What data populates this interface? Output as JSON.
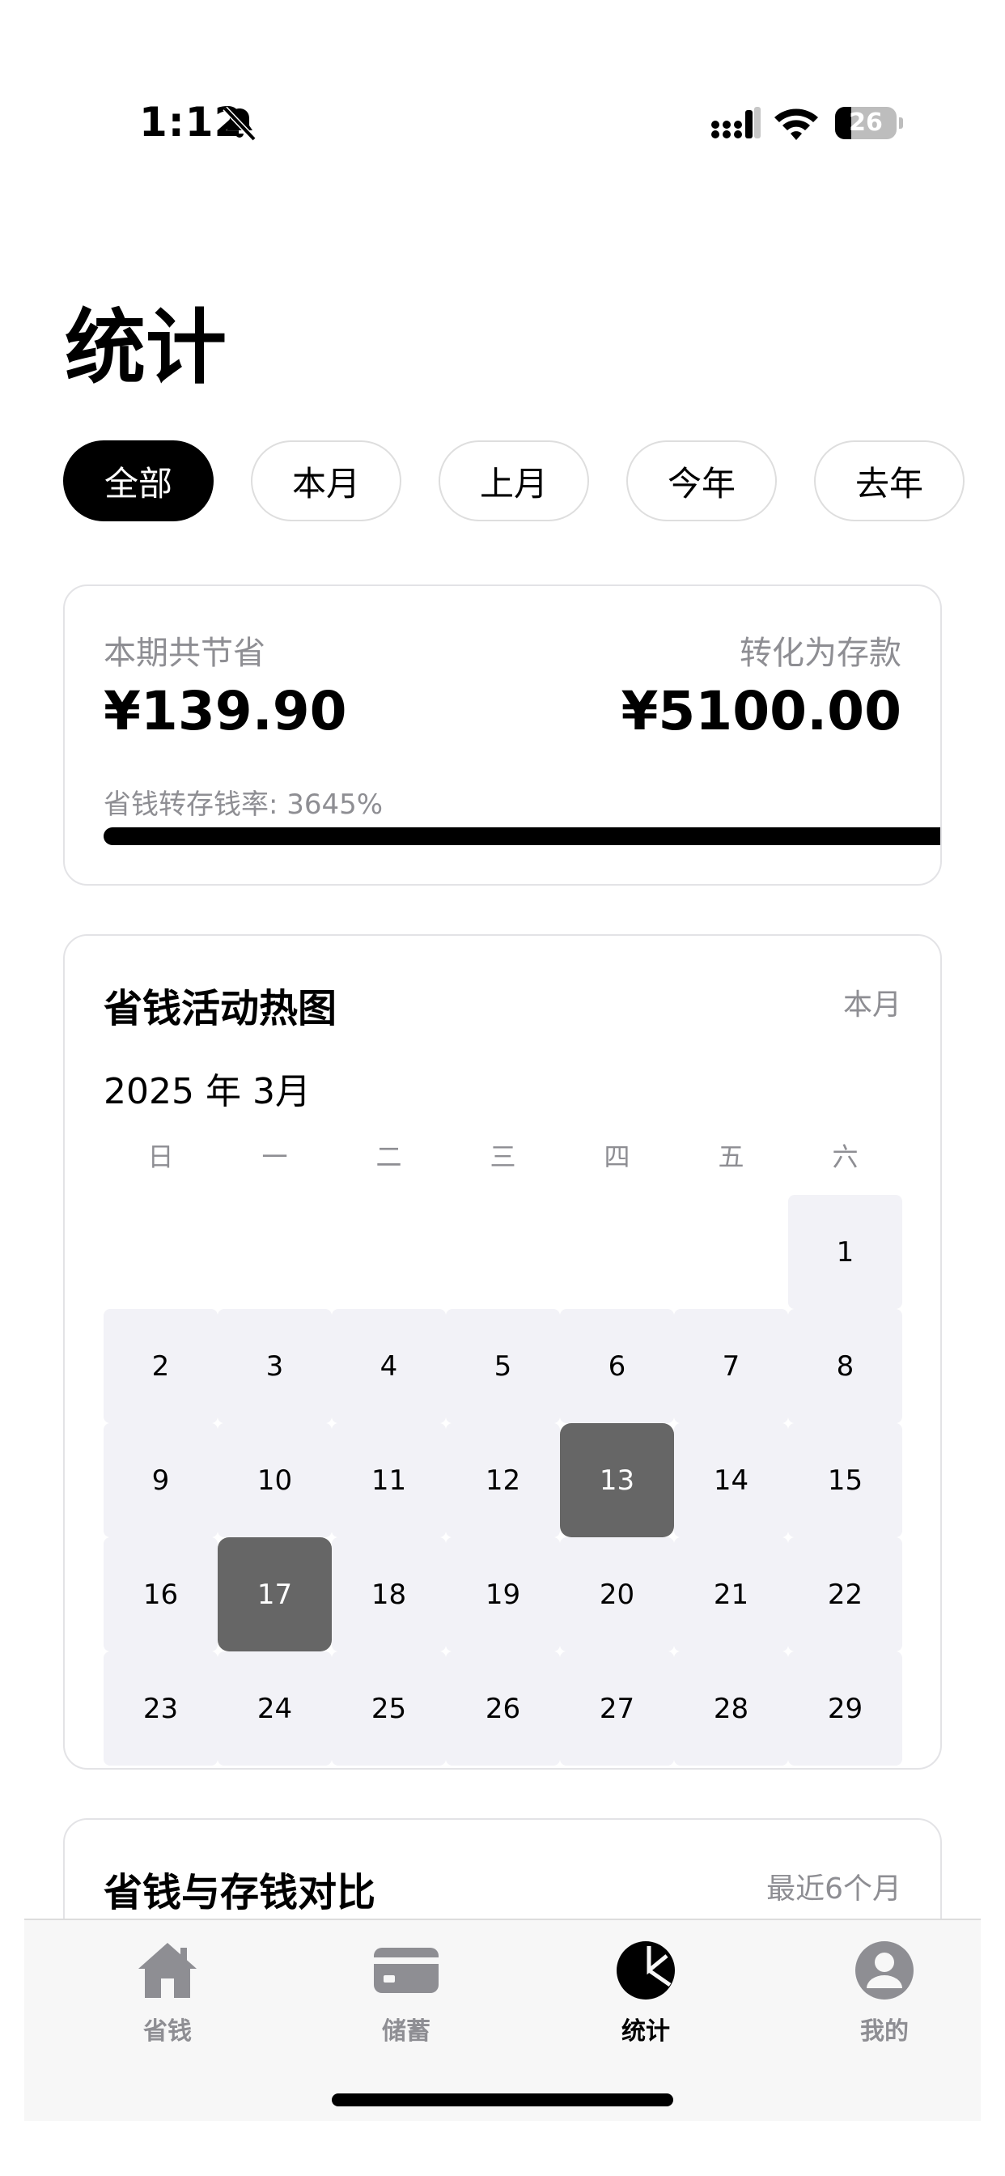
{
  "status_bar": {
    "time": "1:12",
    "battery": "26",
    "battery_level": 0.26
  },
  "page": {
    "title": "统计"
  },
  "filters": [
    {
      "label": "全部",
      "active": true
    },
    {
      "label": "本月",
      "active": false
    },
    {
      "label": "上月",
      "active": false
    },
    {
      "label": "今年",
      "active": false
    },
    {
      "label": "去年",
      "active": false
    }
  ],
  "summary": {
    "saved_label": "本期共节省",
    "saved_amount": "¥139.90",
    "converted_label": "转化为存款",
    "converted_amount": "¥5100.00",
    "rate_text": "省钱转存钱率: 3645%",
    "rate_fill": 1.0
  },
  "heatmap": {
    "title": "省钱活动热图",
    "period": "本月",
    "month": "2025 年 3月",
    "weekdays": [
      "日",
      "一",
      "二",
      "三",
      "四",
      "五",
      "六"
    ],
    "days": [
      "1",
      "2",
      "3",
      "4",
      "5",
      "6",
      "7",
      "8",
      "9",
      "10",
      "11",
      "12",
      "13",
      "14",
      "15",
      "16",
      "17",
      "18",
      "19",
      "20",
      "21",
      "22",
      "23",
      "24",
      "25",
      "26",
      "27",
      "28",
      "29"
    ],
    "hot_days": [
      "13",
      "17"
    ]
  },
  "comparison": {
    "title": "省钱与存钱对比",
    "period": "最近6个月"
  },
  "tabs": [
    {
      "label": "省钱",
      "icon": "home-icon",
      "active": false
    },
    {
      "label": "储蓄",
      "icon": "card-icon",
      "active": false
    },
    {
      "label": "统计",
      "icon": "pie-chart-icon",
      "active": true
    },
    {
      "label": "我的",
      "icon": "profile-icon",
      "active": false
    }
  ],
  "colors": {
    "accent": "#000000",
    "muted": "#8e8e93",
    "cell": "#f2f2f7",
    "hot": "#666666"
  }
}
